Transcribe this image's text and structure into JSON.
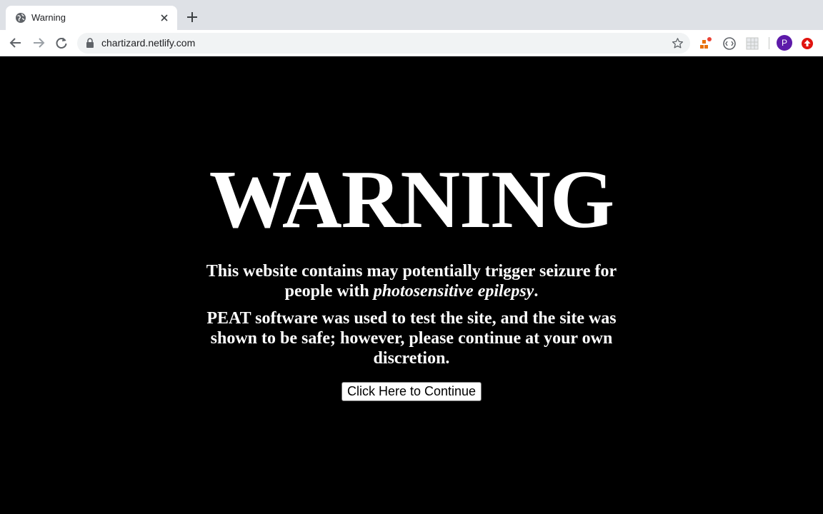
{
  "browser": {
    "tab": {
      "title": "Warning",
      "favicon": "globe-icon"
    },
    "url": "chartizard.netlify.com",
    "profile_initial": "P",
    "colors": {
      "tabstrip": "#dee1e6",
      "avatar": "#5d1aa9"
    }
  },
  "page": {
    "heading": "WARNING",
    "message1_before": "This website contains may potentially trigger seizure for people with ",
    "message1_emphasis": "photosensitive epilepsy",
    "message1_after": ".",
    "message2": "PEAT software was used to test the site, and the site was shown to be safe; however, please continue at your own discretion.",
    "button_label": "Click Here to Continue",
    "colors": {
      "background": "#000000",
      "text": "#ffffff"
    }
  }
}
